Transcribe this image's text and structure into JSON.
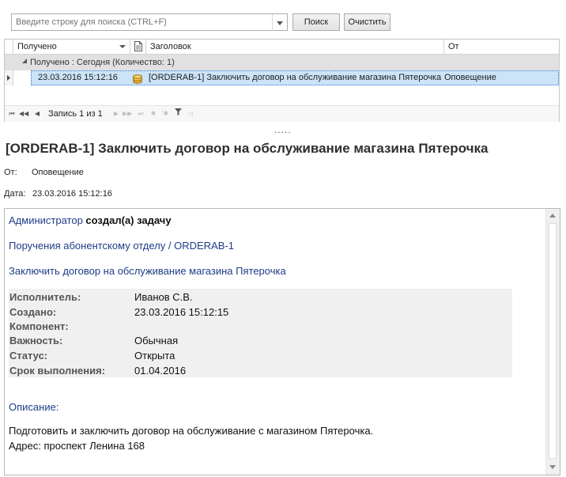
{
  "search": {
    "placeholder": "Введите строку для поиска (CTRL+F)",
    "find_label": "Поиск",
    "clear_label": "Очистить"
  },
  "grid": {
    "columns": {
      "received": "Получено",
      "subject": "Заголовок",
      "from": "От"
    },
    "group_label": "Получено : Сегодня (Количество: 1)",
    "rows": [
      {
        "received": "23.03.2016 15:12:16",
        "subject": "[ORDERAB-1] Заключить договор на обслуживание магазина Пятерочка",
        "from": "Оповещение"
      }
    ],
    "navigator": {
      "record_text": "Запись 1 из 1"
    }
  },
  "splitter_text": ".....",
  "message": {
    "title": "[ORDERAB-1] Заключить договор на обслуживание магазина Пятерочка",
    "from_label": "От:",
    "from_value": "Оповещение",
    "date_label": "Дата:",
    "date_value": "23.03.2016 15:12:16",
    "body": {
      "actor_link": "Администратор",
      "actor_action": "создал(а) задачу",
      "project_link": "Поручения абонентскому отделу / ORDERAB-1",
      "summary_link": "Заключить договор на обслуживание магазина Пятерочка",
      "fields": [
        {
          "label": "Исполнитель:",
          "value": "Иванов С.В."
        },
        {
          "label": "Создано:",
          "value": "23.03.2016 15:12:15"
        },
        {
          "label": "Компонент:",
          "value": ""
        },
        {
          "label": "Важность:",
          "value": "Обычная"
        },
        {
          "label": "Статус:",
          "value": "Открыта"
        },
        {
          "label": "Срок выполнения:",
          "value": "01.04.2016"
        }
      ],
      "description_label": "Описание:",
      "description_line1": "Подготовить и заключить договор на обслуживание с магазином Пятерочка.",
      "description_line2": "Адрес: проспект Ленина 168"
    }
  },
  "colors": {
    "selection": "#cce4f7",
    "link": "#1f3c88",
    "group_bg": "#e1e1e1"
  }
}
